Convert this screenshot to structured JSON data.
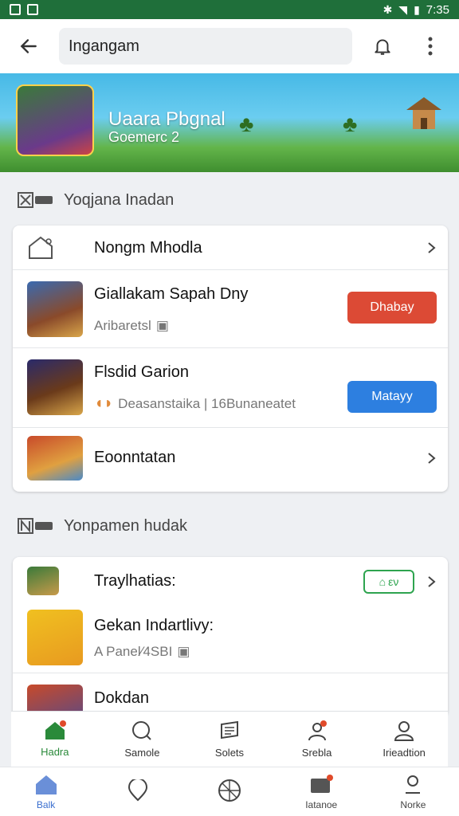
{
  "status_bar": {
    "time": "7:35"
  },
  "app_bar": {
    "search_value": "Ingangam"
  },
  "banner": {
    "title": "Uaara Pbgnal",
    "subtitle": "Goemerc 2"
  },
  "section1": {
    "heading": "Yoqjana Inadan",
    "items": [
      {
        "title": "Nongm Mhodla"
      },
      {
        "title": "Giallakam  Sapah Dny",
        "subtitle": "Aribaretsl",
        "button": "Dhabay"
      },
      {
        "title": "Flsdid Garion",
        "subtitle": "Deasanstaika | 16Bunaneatet",
        "button": "Matayy"
      },
      {
        "title": "Eoonntatan"
      }
    ]
  },
  "section2": {
    "heading": "Yonpamen hudak",
    "items": [
      {
        "title": "Traylhatias:",
        "pill": "εν"
      },
      {
        "title": "Gekan Indartlivy:",
        "subtitle": "A Panel⁄4SBI"
      },
      {
        "title": "Dokdan"
      }
    ]
  },
  "bottom_tabs": [
    {
      "label": "Hadra",
      "icon": "home-icon",
      "active": true
    },
    {
      "label": "Samole",
      "icon": "search-icon"
    },
    {
      "label": "Solets",
      "icon": "notes-icon"
    },
    {
      "label": "Srebla",
      "icon": "profile-badge-icon"
    },
    {
      "label": "Irieadtion",
      "icon": "user-icon"
    }
  ],
  "system_nav": [
    {
      "label": "Balk",
      "icon": "home-icon",
      "active": true
    },
    {
      "label": "",
      "icon": "location-icon"
    },
    {
      "label": "",
      "icon": "compass-icon"
    },
    {
      "label": "Iatanoe",
      "icon": "wallet-icon"
    },
    {
      "label": "Norke",
      "icon": "person-icon"
    }
  ],
  "colors": {
    "status_bar": "#1f6f3a",
    "accent_red": "#dc4a35",
    "accent_blue": "#2d7fe0",
    "accent_green": "#2ea44f",
    "active_tab": "#2a8a3a"
  }
}
